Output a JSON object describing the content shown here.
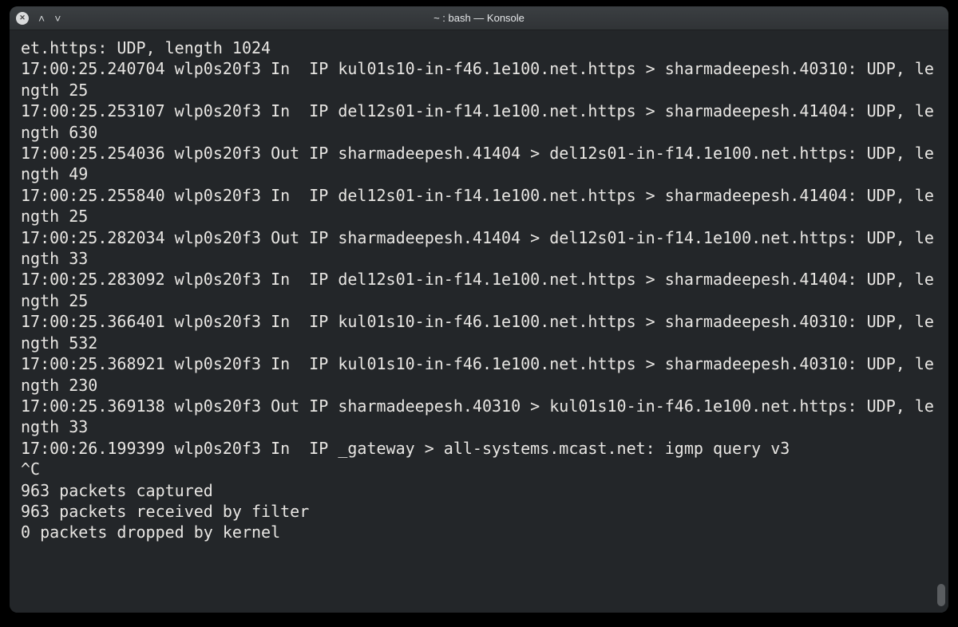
{
  "window": {
    "title": "~ : bash — Konsole"
  },
  "terminal": {
    "lines": [
      "et.https: UDP, length 1024",
      "17:00:25.240704 wlp0s20f3 In  IP kul01s10-in-f46.1e100.net.https > sharmadeepesh.40310: UDP, length 25",
      "17:00:25.253107 wlp0s20f3 In  IP del12s01-in-f14.1e100.net.https > sharmadeepesh.41404: UDP, length 630",
      "17:00:25.254036 wlp0s20f3 Out IP sharmadeepesh.41404 > del12s01-in-f14.1e100.net.https: UDP, length 49",
      "17:00:25.255840 wlp0s20f3 In  IP del12s01-in-f14.1e100.net.https > sharmadeepesh.41404: UDP, length 25",
      "17:00:25.282034 wlp0s20f3 Out IP sharmadeepesh.41404 > del12s01-in-f14.1e100.net.https: UDP, length 33",
      "17:00:25.283092 wlp0s20f3 In  IP del12s01-in-f14.1e100.net.https > sharmadeepesh.41404: UDP, length 25",
      "17:00:25.366401 wlp0s20f3 In  IP kul01s10-in-f46.1e100.net.https > sharmadeepesh.40310: UDP, length 532",
      "17:00:25.368921 wlp0s20f3 In  IP kul01s10-in-f46.1e100.net.https > sharmadeepesh.40310: UDP, length 230",
      "17:00:25.369138 wlp0s20f3 Out IP sharmadeepesh.40310 > kul01s10-in-f46.1e100.net.https: UDP, length 33",
      "17:00:26.199399 wlp0s20f3 In  IP _gateway > all-systems.mcast.net: igmp query v3",
      "^C",
      "963 packets captured",
      "963 packets received by filter",
      "0 packets dropped by kernel"
    ]
  }
}
